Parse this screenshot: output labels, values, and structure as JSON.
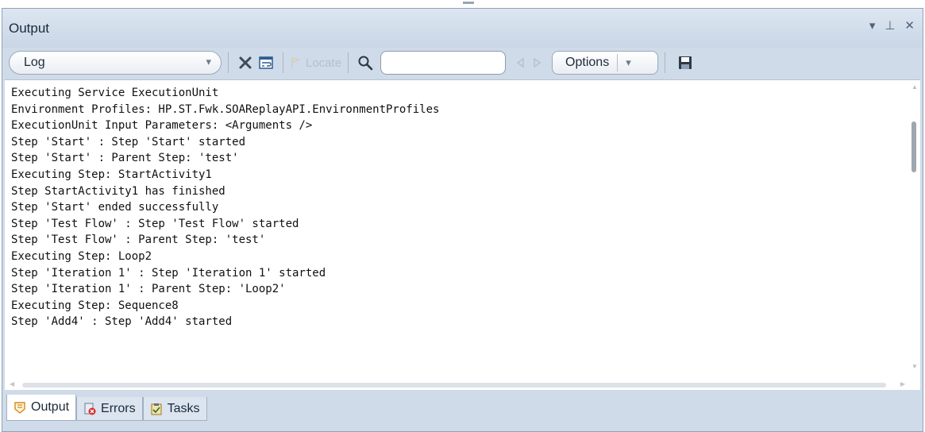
{
  "panel": {
    "title": "Output",
    "controls": {
      "dropdown_icon": "▾",
      "pin_icon": "⊥",
      "close_icon": "✕"
    }
  },
  "toolbar": {
    "view_select": {
      "value": "Log",
      "arrow": "▾"
    },
    "locate_label": "Locate",
    "search": {
      "value": "",
      "placeholder": ""
    },
    "options_label": "Options",
    "options_arrow": "▾"
  },
  "log_lines": [
    "Executing Service ExecutionUnit",
    "Environment Profiles: HP.ST.Fwk.SOAReplayAPI.EnvironmentProfiles",
    "ExecutionUnit Input Parameters: <Arguments />",
    "Step 'Start' : Step 'Start' started",
    "Step 'Start' : Parent Step: 'test'",
    "Executing Step: StartActivity1",
    "Step StartActivity1 has finished",
    "Step 'Start' ended successfully",
    "Step 'Test Flow' : Step 'Test Flow' started",
    "Step 'Test Flow' : Parent Step: 'test'",
    "Executing Step: Loop2",
    "Step 'Iteration 1' : Step 'Iteration 1' started",
    "Step 'Iteration 1' : Parent Step: 'Loop2'",
    "Executing Step: Sequence8",
    "Step 'Add4' : Step 'Add4' started"
  ],
  "tabs": [
    {
      "label": "Output",
      "icon": "output-icon",
      "active": true
    },
    {
      "label": "Errors",
      "icon": "errors-icon",
      "active": false
    },
    {
      "label": "Tasks",
      "icon": "tasks-icon",
      "active": false
    }
  ],
  "colors": {
    "panel_bg": "#cfdbe8",
    "title_text": "#1b2a3a",
    "log_text": "#101010"
  }
}
